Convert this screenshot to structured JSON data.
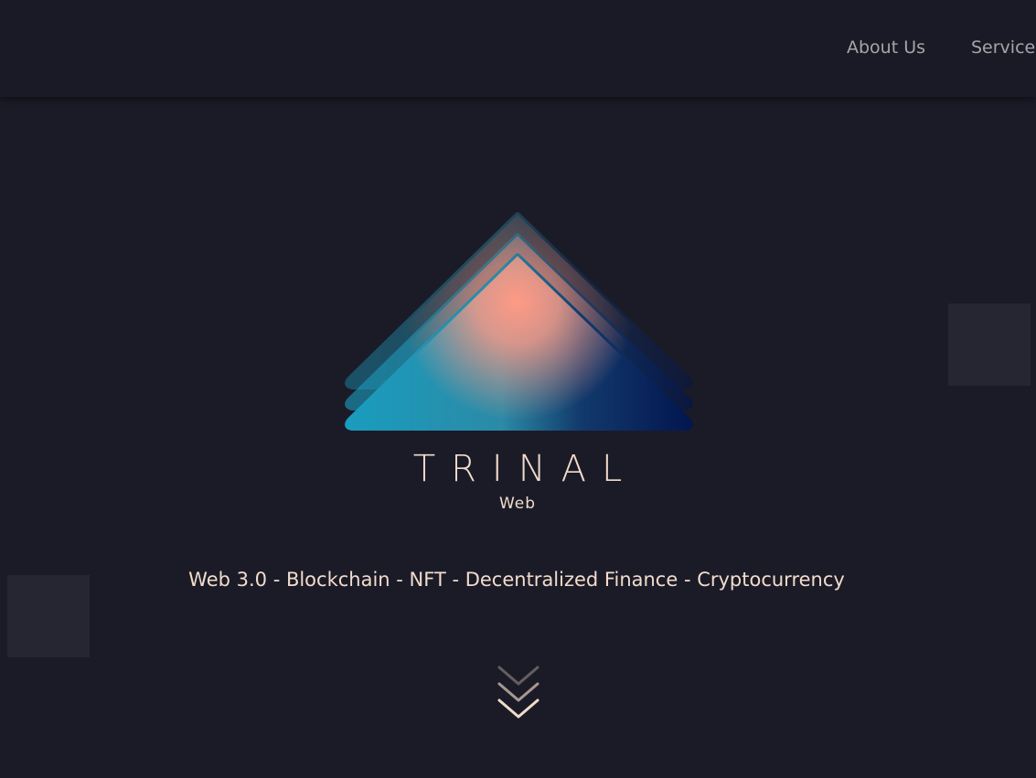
{
  "nav": {
    "items": [
      {
        "label": "About Us"
      },
      {
        "label": "Services"
      }
    ]
  },
  "hero": {
    "brand_name": "TRINAL",
    "brand_sub": "Web",
    "tagline": "Web 3.0 - Blockchain - NFT - Decentralized Finance - Cryptocurrency",
    "scroll_icon": "triple-chevron-down-icon"
  },
  "colors": {
    "background": "#1b1b28",
    "navbar": "#1a1a27",
    "nav_text": "#a8a4a8",
    "accent_text": "#f2dccb",
    "logo_teal": "#1a9cbe",
    "logo_coral": "#ff9a84",
    "logo_navy": "#03164f"
  }
}
